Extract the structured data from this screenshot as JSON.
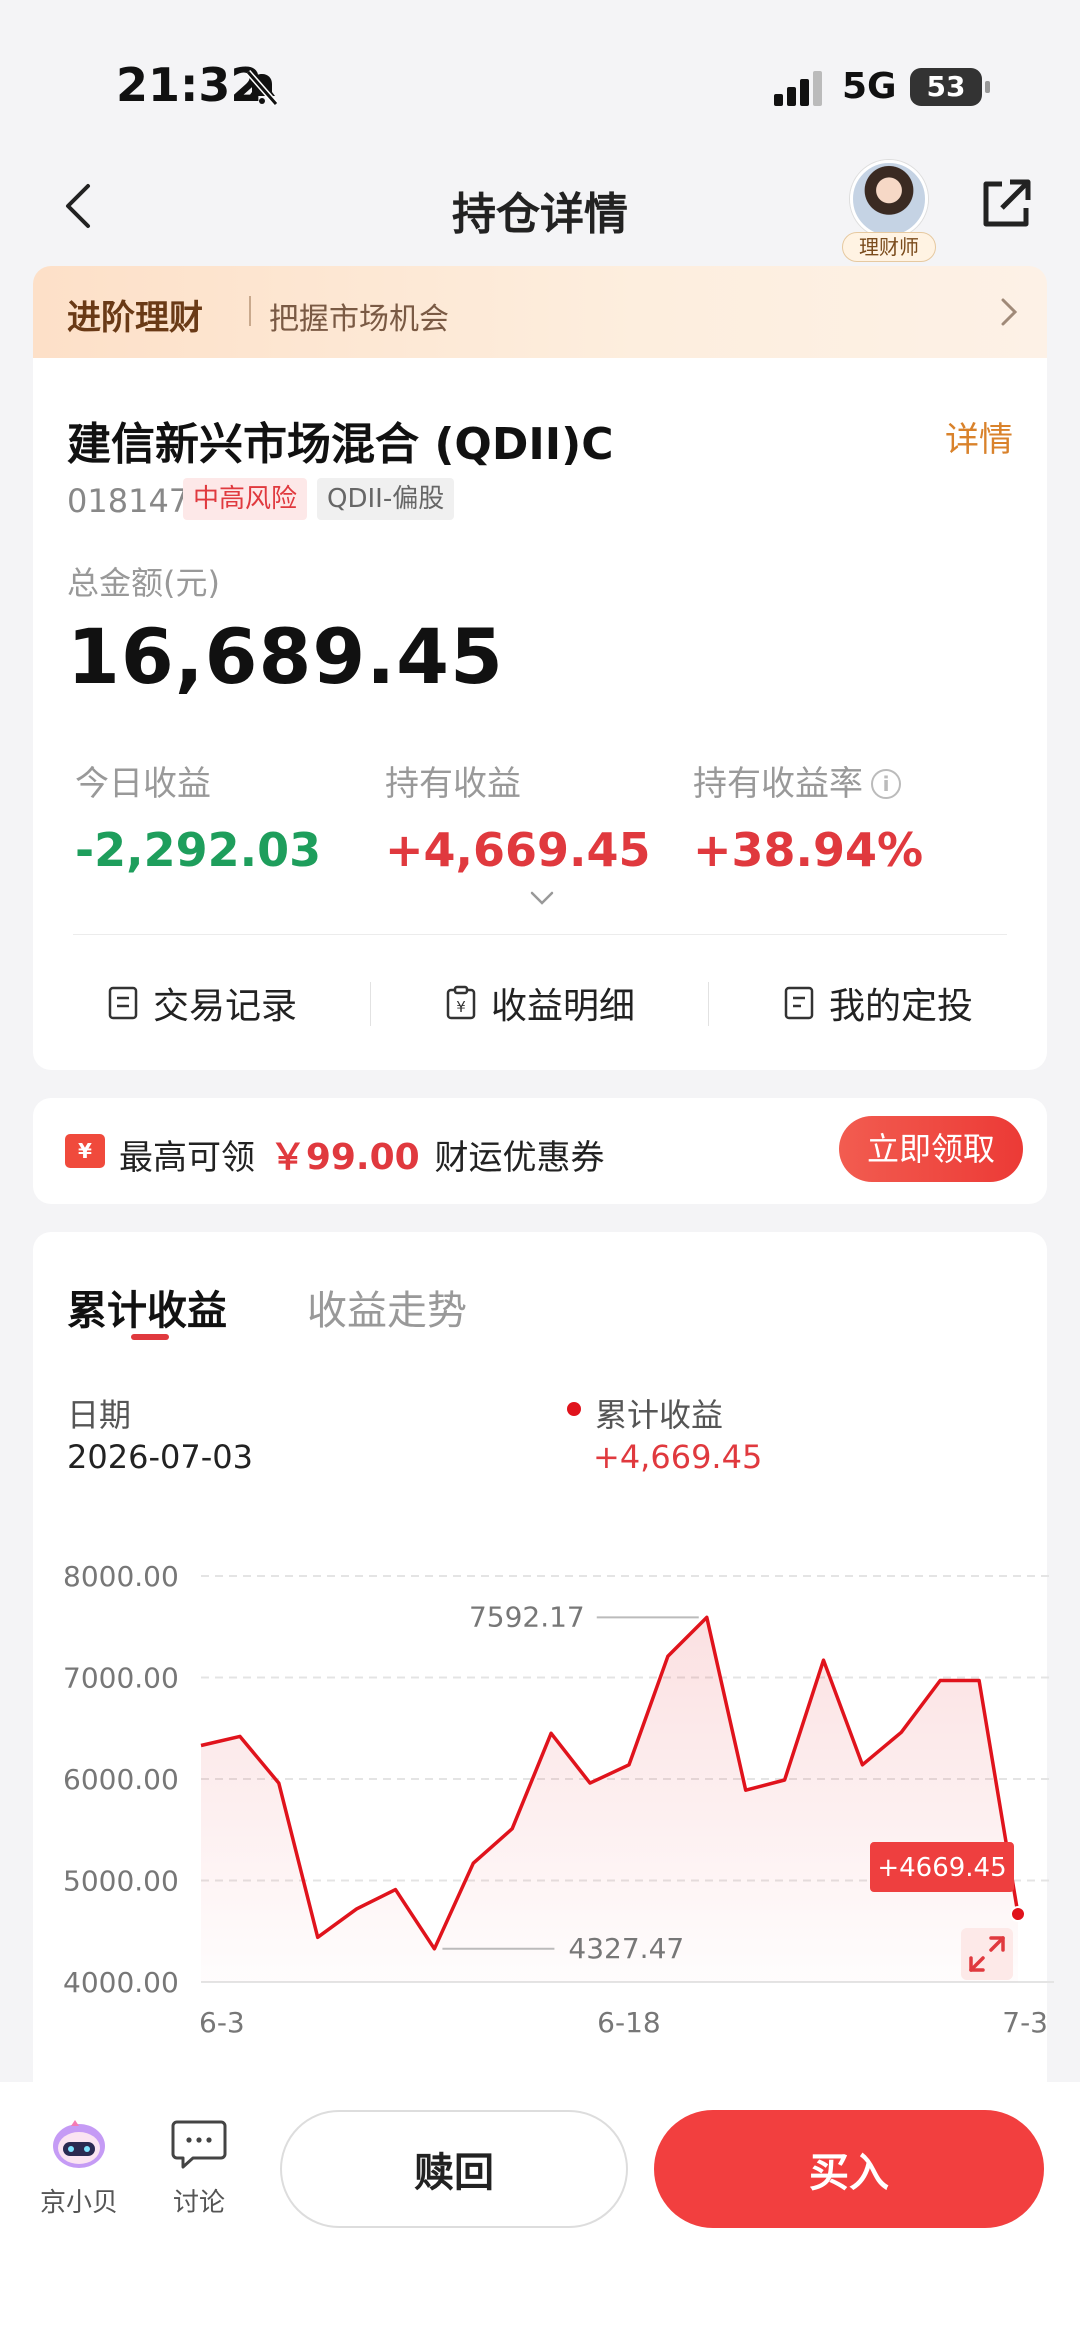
{
  "status_bar": {
    "time": "21:32",
    "network": "5G",
    "battery": "53"
  },
  "nav": {
    "title": "持仓详情",
    "advisor_label": "理财师"
  },
  "banner": {
    "title": "进阶理财",
    "subtitle": "把握市场机会"
  },
  "fund": {
    "name": "建信新兴市场混合 (QDII)C",
    "detail_link": "详情",
    "code": "018147",
    "risk_tag": "中高风险",
    "type_tag": "QDII-偏股",
    "total_label": "总金额(元)",
    "total_value": "16,689.45",
    "metrics": {
      "today_label": "今日收益",
      "today_value": "-2,292.03",
      "hold_label": "持有收益",
      "hold_value": "+4,669.45",
      "rate_label": "持有收益率",
      "rate_value": "+38.94%"
    },
    "actions": {
      "trade": "交易记录",
      "income": "收益明细",
      "plan": "我的定投"
    }
  },
  "coupon": {
    "icon_text": "¥",
    "prefix": "最高可领",
    "amount": "￥99.00",
    "suffix": "财运优惠券",
    "button": "立即领取"
  },
  "chart_section": {
    "tab_active": "累计收益",
    "tab_inactive": "收益走势",
    "date_label": "日期",
    "date_value": "2026-07-03",
    "series_label": "累计收益",
    "series_value": "+4,669.45",
    "colors": {
      "line": "#e0131c",
      "grid": "#e4e4e4"
    }
  },
  "chart_data": {
    "type": "area",
    "title": "累计收益",
    "ylim": [
      4000,
      8000
    ],
    "y_ticks": [
      "8000.00",
      "7000.00",
      "6000.00",
      "5000.00",
      "4000.00"
    ],
    "x_ticks": [
      "6-3",
      "6-18",
      "7-3"
    ],
    "series": [
      {
        "name": "累计收益",
        "values": [
          6330,
          6420,
          5960,
          4440,
          4720,
          4910,
          4327.47,
          5170,
          5510,
          6450,
          5960,
          6140,
          7210,
          7592.17,
          5890,
          5990,
          7170,
          6140,
          6460,
          6970,
          6970,
          4669.45
        ]
      }
    ],
    "annotations": {
      "max_label": "7592.17",
      "min_label": "4327.47",
      "last_label": "+4669.45"
    },
    "grid": true
  },
  "bottom_bar": {
    "jxb_label": "京小贝",
    "discuss_label": "讨论",
    "redeem": "赎回",
    "buy": "买入"
  }
}
